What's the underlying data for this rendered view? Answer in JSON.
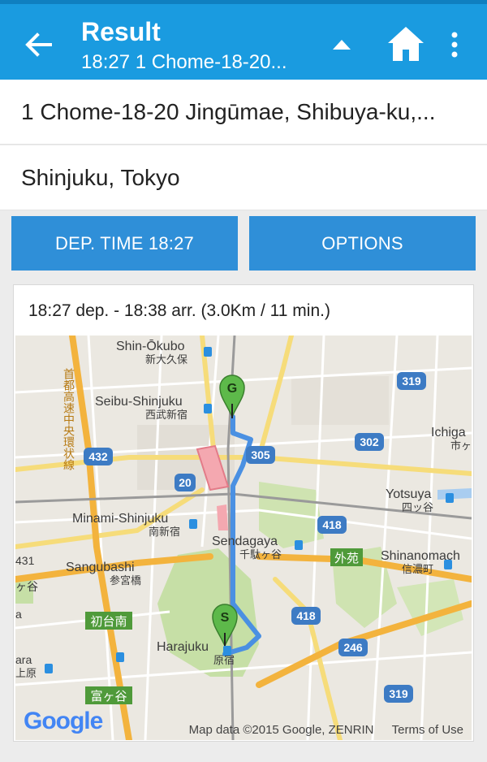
{
  "header": {
    "title": "Result",
    "subtitle": "18:27 1 Chome-18-20..."
  },
  "route": {
    "from": "1 Chome-18-20 Jingūmae, Shibuya-ku,...",
    "to": "Shinjuku, Tokyo"
  },
  "buttons": {
    "departure": "DEP. TIME 18:27",
    "options": "OPTIONS"
  },
  "result": {
    "summary": "18:27 dep. - 18:38 arr. (3.0Km / 11 min.)"
  },
  "map": {
    "labels": {
      "shin_okubo": "Shin-Ōkubo",
      "shin_okubo_jp": "新大久保",
      "seibu_shinjuku": "Seibu-Shinjuku",
      "seibu_shinjuku_jp": "西武新宿",
      "minami_shinjuku": "Minami-Shinjuku",
      "minami_shinjuku_jp": "南新宿",
      "sangubashi": "Sangubashi",
      "sangubashi_jp": "参宮橋",
      "sendagaya": "Sendagaya",
      "sendagaya_jp": "千駄ヶ谷",
      "harajuku": "Harajuku",
      "harajuku_jp": "原宿",
      "yotsuya": "Yotsuya",
      "yotsuya_jp": "四ッ谷",
      "ichigaya": "Ichiga",
      "ichigaya_jp": "市ヶ",
      "shinanomachi": "Shinanomach",
      "shinanomachi_jp": "信濃町",
      "gaien": "外苑",
      "hatsudai": "初台南",
      "tomigaya": "富ヶ谷",
      "expressway": "首都高速中央環状線",
      "left_431": "431",
      "left_gaya": "ヶ谷",
      "left_a": "a",
      "left_ara": "ara",
      "left_jp": "上原"
    },
    "shields": [
      "319",
      "432",
      "305",
      "302",
      "20",
      "418",
      "418",
      "246",
      "319"
    ],
    "markers": {
      "goal": "G",
      "start": "S"
    },
    "logo": "Google",
    "attribution": "Map data ©2015 Google, ZENRIN",
    "terms": "Terms of Use",
    "colors": {
      "route": "#4a90e2",
      "marker": "#5db94a",
      "water": "#a9cdf0",
      "park": "#c6dfa6",
      "highway": "#f3b33d"
    }
  }
}
